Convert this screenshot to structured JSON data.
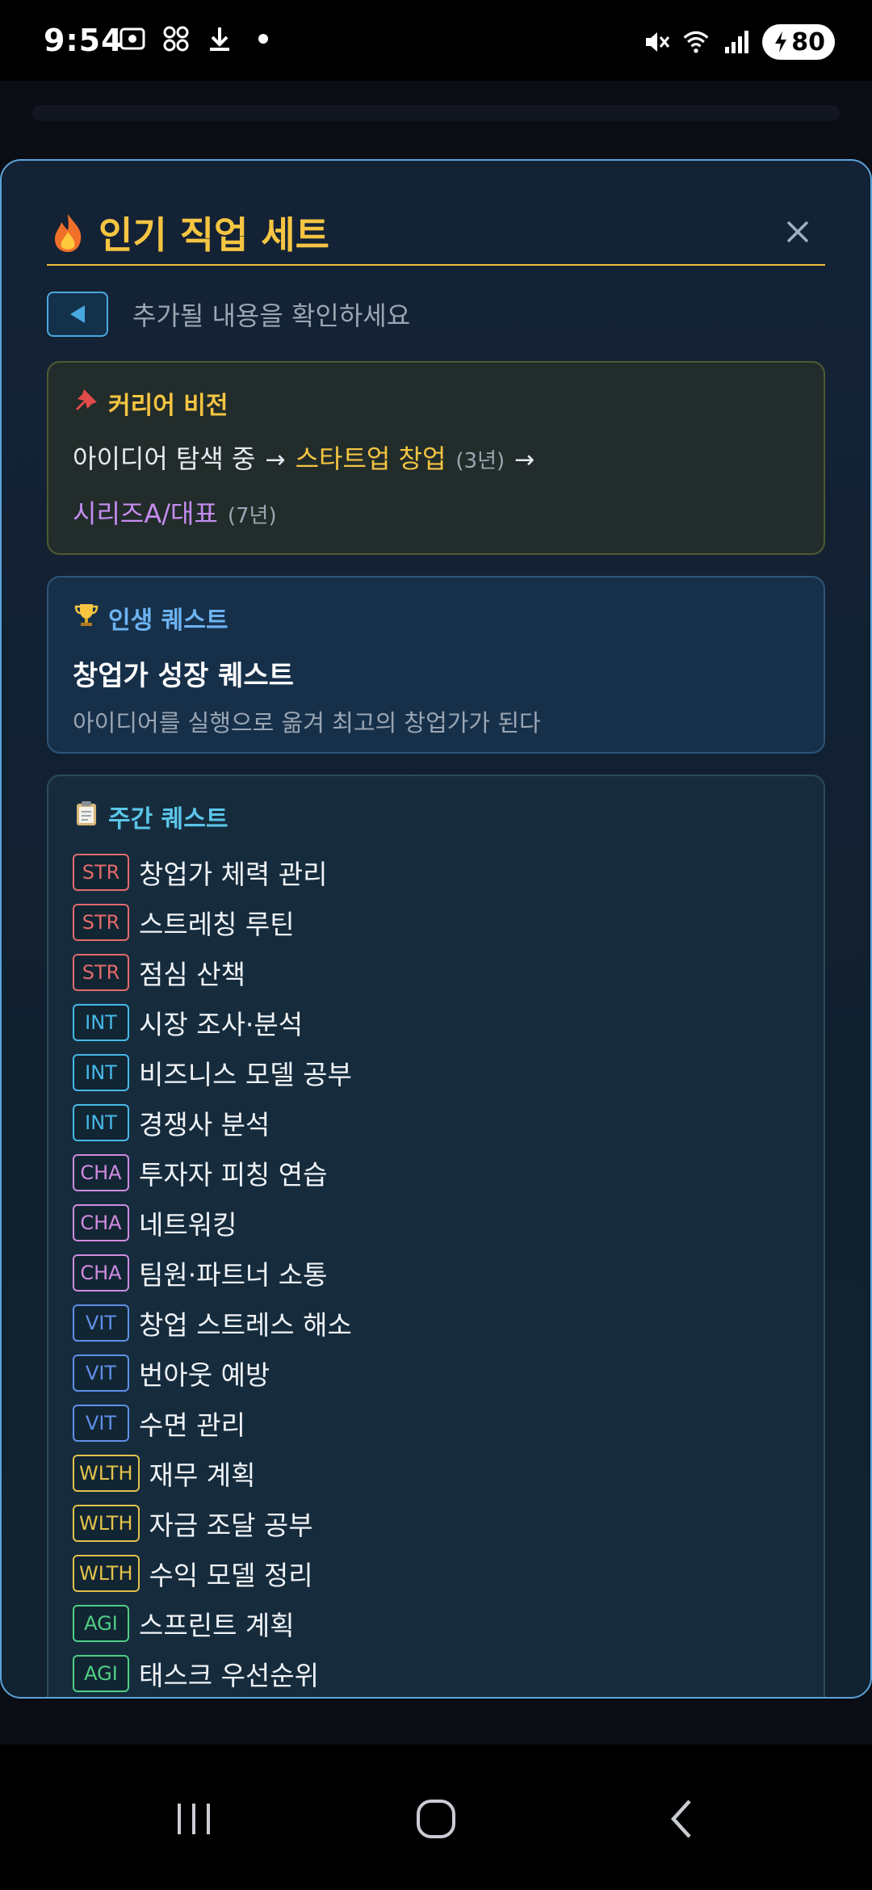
{
  "status_bar": {
    "time": "9:54",
    "battery": "80",
    "icons": [
      "screenshot-icon",
      "app-icon",
      "download-icon",
      "dot-icon",
      "mute-icon",
      "wifi-icon",
      "signal-icon",
      "battery-icon"
    ]
  },
  "modal": {
    "title": "인기 직업 세트",
    "title_icon": "fire-icon",
    "close_icon": "close-icon",
    "back_hint": "추가될 내용을 확인하세요"
  },
  "vision": {
    "title": "커리어 비전",
    "icon": "pin-icon",
    "step1": "아이디어 탐색 중",
    "step2": "스타트업 창업",
    "step2_years": "(3년)",
    "step3": "시리즈A/대표",
    "step3_years": "(7년)"
  },
  "life_quest": {
    "title": "인생 퀘스트",
    "icon": "trophy-icon",
    "name": "창업가 성장 퀘스트",
    "description": "아이디어를 실행으로 옮겨 최고의 창업가가 된다"
  },
  "weekly": {
    "title": "주간 퀘스트",
    "icon": "clipboard-icon",
    "items": [
      {
        "tag": "STR",
        "text": "창업가 체력 관리"
      },
      {
        "tag": "STR",
        "text": "스트레칭 루틴"
      },
      {
        "tag": "STR",
        "text": "점심 산책"
      },
      {
        "tag": "INT",
        "text": "시장 조사·분석"
      },
      {
        "tag": "INT",
        "text": "비즈니스 모델 공부"
      },
      {
        "tag": "INT",
        "text": "경쟁사 분석"
      },
      {
        "tag": "CHA",
        "text": "투자자 피칭 연습"
      },
      {
        "tag": "CHA",
        "text": "네트워킹"
      },
      {
        "tag": "CHA",
        "text": "팀원·파트너 소통"
      },
      {
        "tag": "VIT",
        "text": "창업 스트레스 해소"
      },
      {
        "tag": "VIT",
        "text": "번아웃 예방"
      },
      {
        "tag": "VIT",
        "text": "수면 관리"
      },
      {
        "tag": "WLTH",
        "text": "재무 계획"
      },
      {
        "tag": "WLTH",
        "text": "자금 조달 공부"
      },
      {
        "tag": "WLTH",
        "text": "수익 모델 정리"
      },
      {
        "tag": "AGI",
        "text": "스프린트 계획"
      },
      {
        "tag": "AGI",
        "text": "태스크 우선순위"
      }
    ]
  },
  "colors": {
    "accent_gold": "#f5c542",
    "accent_blue": "#5ba3d9",
    "STR": "#e26a6a",
    "INT": "#47b8e8",
    "CHA": "#d08be0",
    "VIT": "#5f8fe8",
    "WLTH": "#e3c24a",
    "AGI": "#4fcf84"
  }
}
